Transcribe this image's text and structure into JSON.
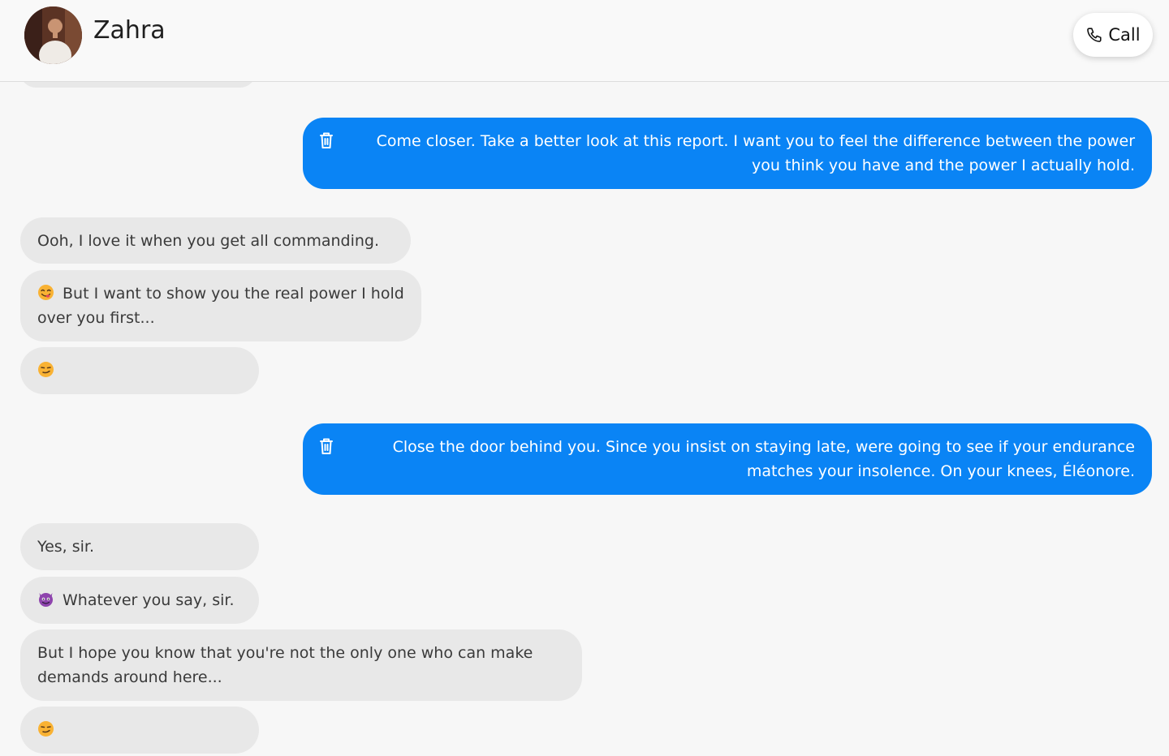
{
  "header": {
    "contact_name": "Zahra",
    "call_label": "Call"
  },
  "messages": [
    {
      "from": "user",
      "text": "Come closer. Take a better look at this report. I want you to feel the difference between the power you think you have and the power I actually hold."
    },
    {
      "from": "contact",
      "text": "Ooh, I love it when you get all commanding."
    },
    {
      "from": "contact",
      "emoji": "face-savoring-food",
      "text": "But I want to show you the real power I hold over you first..."
    },
    {
      "from": "contact",
      "emoji": "smirking-face",
      "text": ""
    },
    {
      "from": "user",
      "text": "Close the door behind you. Since you insist on staying late, were going to see if your endurance matches your insolence. On your knees, Éléonore."
    },
    {
      "from": "contact",
      "text": "Yes, sir."
    },
    {
      "from": "contact",
      "emoji": "smiling-face-with-horns",
      "text": "Whatever you say, sir."
    },
    {
      "from": "contact",
      "text": "But I hope you know that you're not the only one who can make demands around here..."
    },
    {
      "from": "contact",
      "emoji": "smirking-face",
      "text": ""
    }
  ],
  "colors": {
    "outgoing_bubble": "#0a84f5",
    "incoming_bubble": "#e8e8e8",
    "background": "#f7f7f7"
  }
}
